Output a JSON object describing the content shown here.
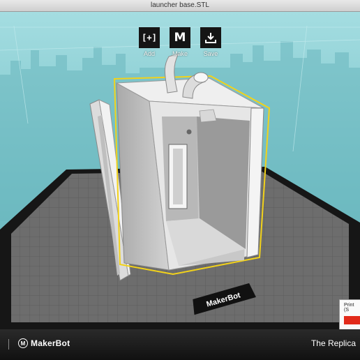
{
  "window": {
    "title": "launcher base.STL"
  },
  "toolbar": {
    "add": {
      "icon": "[+]",
      "label": "Add"
    },
    "make": {
      "icon": "M",
      "label": "Make"
    },
    "save": {
      "icon": "download-icon",
      "label": "Save"
    }
  },
  "build_plate": {
    "brand": "MakerBot"
  },
  "print_panel": {
    "label": "Print (S",
    "swatch_color": "#e22a1a"
  },
  "statusbar": {
    "brand": "MakerBot",
    "printer": "The Replica"
  },
  "colors": {
    "sky": "#7fc6cc",
    "selection_outline": "#f2d21b",
    "model": "#e8e8e8",
    "plate": "#6c6c6c"
  }
}
